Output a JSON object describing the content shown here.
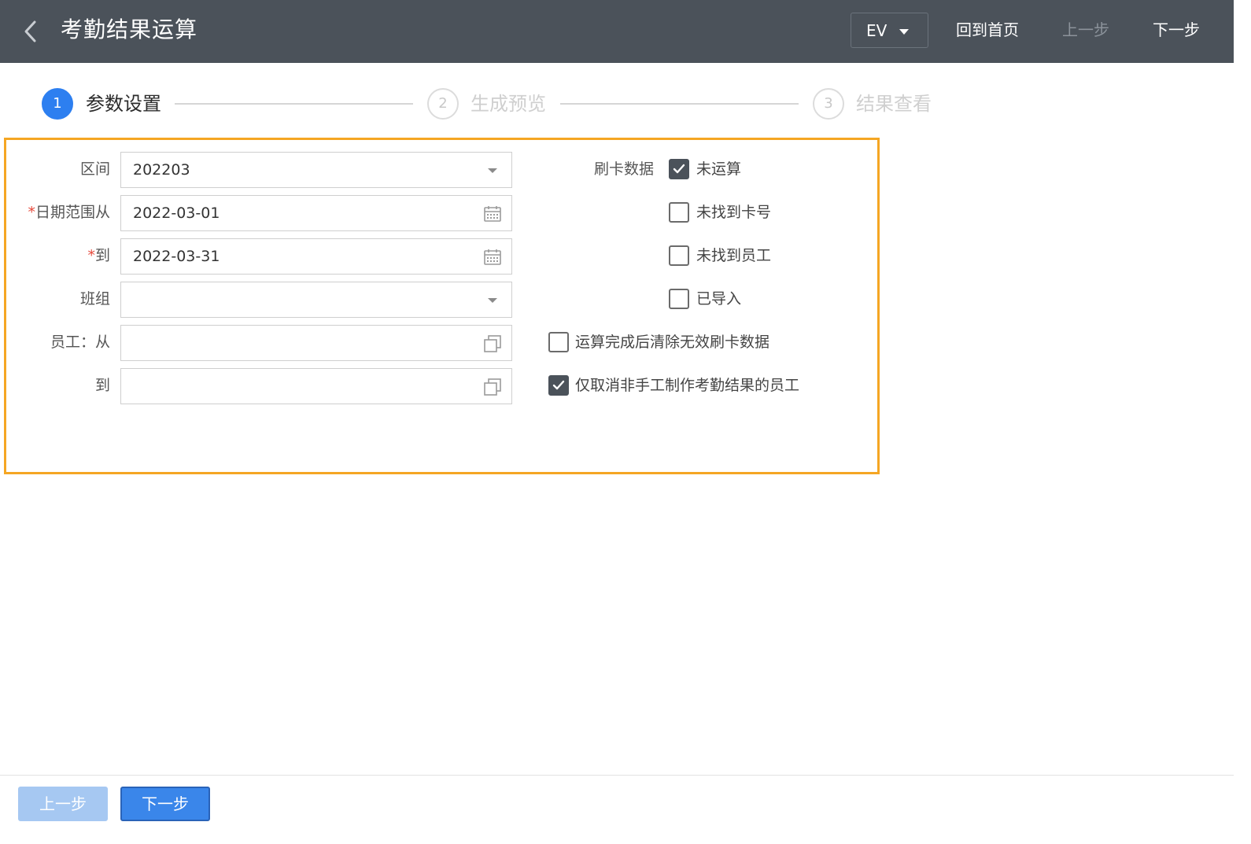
{
  "header": {
    "title": "考勤结果运算",
    "env": "EV",
    "home": "回到首页",
    "prev": "上一步",
    "next": "下一步"
  },
  "steps": [
    {
      "num": "1",
      "label": "参数设置",
      "state": "active"
    },
    {
      "num": "2",
      "label": "生成预览",
      "state": "inactive"
    },
    {
      "num": "3",
      "label": "结果查看",
      "state": "inactive"
    }
  ],
  "form": {
    "period": {
      "label": "区间",
      "value": "202203"
    },
    "date_from": {
      "required": "*",
      "label": "日期范围从",
      "value": "2022-03-01"
    },
    "date_to": {
      "required": "*",
      "label": "到",
      "value": "2022-03-31"
    },
    "team": {
      "label": "班组",
      "value": ""
    },
    "emp_from": {
      "label": "员工：从",
      "value": ""
    },
    "emp_to": {
      "label": "到",
      "value": ""
    }
  },
  "card_data": {
    "label": "刷卡数据",
    "options": [
      {
        "label": "未运算",
        "checked": true
      },
      {
        "label": "未找到卡号",
        "checked": false
      },
      {
        "label": "未找到员工",
        "checked": false
      },
      {
        "label": "已导入",
        "checked": false
      }
    ]
  },
  "options": {
    "clear_invalid": {
      "label": "运算完成后清除无效刷卡数据",
      "checked": false
    },
    "only_non_manual": {
      "label": "仅取消非手工制作考勤结果的员工",
      "checked": true
    }
  },
  "footer": {
    "prev": "上一步",
    "next": "下一步"
  },
  "colors": {
    "header_bg": "#4b525a",
    "accent": "#2d7ff0",
    "highlight_border": "#f5a623"
  }
}
